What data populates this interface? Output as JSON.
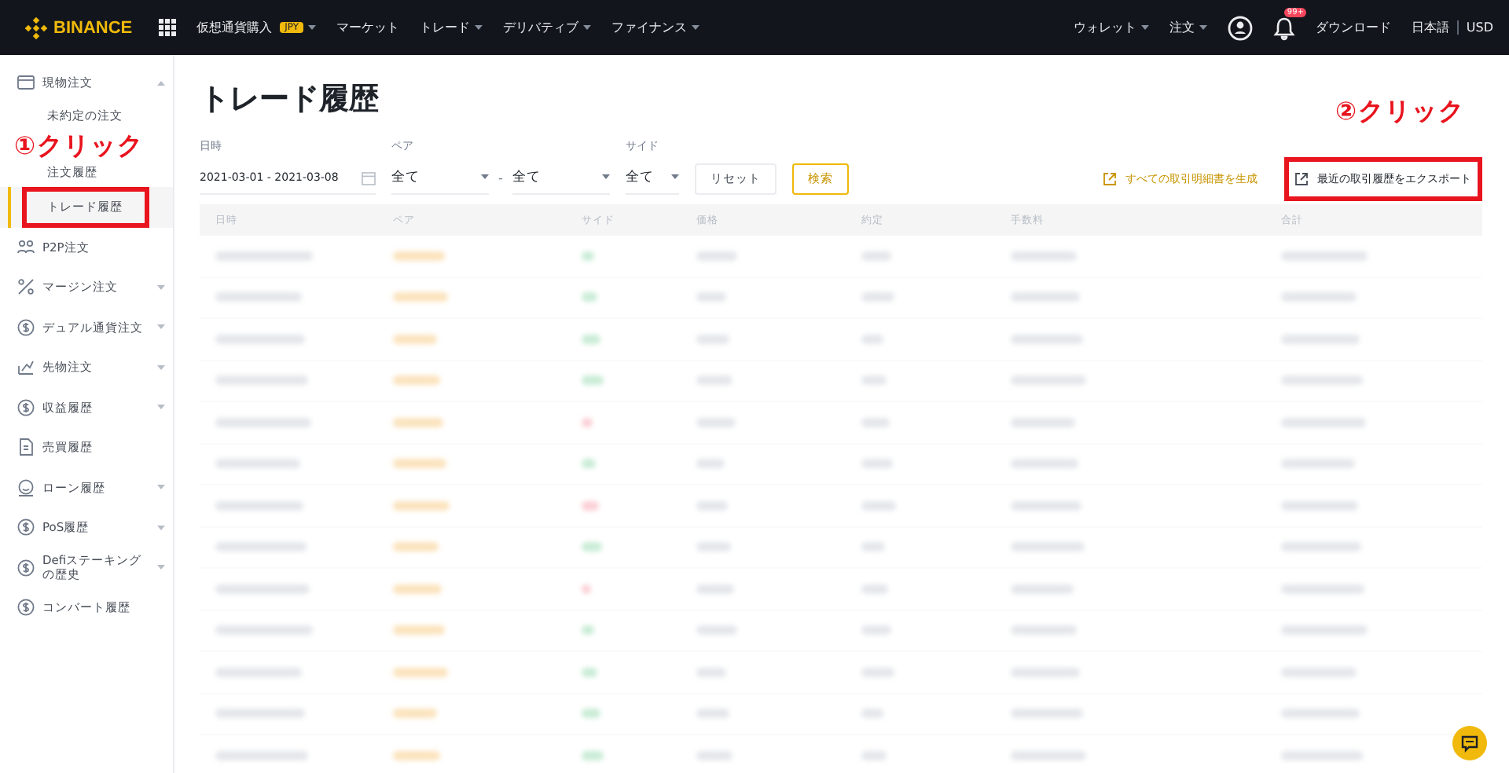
{
  "nav": {
    "logo": "BINANCE",
    "left": [
      {
        "label": "仮想通貨購入",
        "badge": "JPY",
        "dropdown": true
      },
      {
        "label": "マーケット",
        "dropdown": false
      },
      {
        "label": "トレード",
        "dropdown": true
      },
      {
        "label": "デリバティブ",
        "dropdown": true
      },
      {
        "label": "ファイナンス",
        "dropdown": true
      }
    ],
    "right": [
      {
        "kind": "link",
        "label": "ウォレット",
        "dropdown": true
      },
      {
        "kind": "link",
        "label": "注文",
        "dropdown": true
      },
      {
        "kind": "user"
      },
      {
        "kind": "bell",
        "badge": "99+"
      },
      {
        "kind": "link",
        "label": "ダウンロード",
        "dropdown": false
      },
      {
        "kind": "locale",
        "language": "日本語",
        "currency": "USD"
      }
    ]
  },
  "sidebar": {
    "items": [
      {
        "kind": "wallet",
        "label": "現物注文",
        "expandable": true,
        "expanded": true,
        "children": [
          {
            "label": "未約定の注文",
            "selected": false,
            "highlighted": false
          },
          {
            "label": "注文履歴",
            "selected": false,
            "highlighted": false
          },
          {
            "label": "トレード履歴",
            "selected": true,
            "highlighted": true
          }
        ]
      },
      {
        "kind": "p2p",
        "label": "P2P注文",
        "expandable": false
      },
      {
        "kind": "margin",
        "label": "マージン注文",
        "expandable": true,
        "expanded": false
      },
      {
        "kind": "coin",
        "label": "デュアル通貨注文",
        "expandable": true,
        "expanded": false
      },
      {
        "kind": "futures",
        "label": "先物注文",
        "expandable": true,
        "expanded": false
      },
      {
        "kind": "coin",
        "label": "収益履歴",
        "expandable": true,
        "expanded": false
      },
      {
        "kind": "document",
        "label": "売買履歴",
        "expandable": false
      },
      {
        "kind": "loan",
        "label": "ローン履歴",
        "expandable": true,
        "expanded": false
      },
      {
        "kind": "coin",
        "label": "PoS履歴",
        "expandable": true,
        "expanded": false
      },
      {
        "kind": "coin",
        "label": "Defiステーキングの歴史",
        "expandable": true,
        "expanded": false
      },
      {
        "kind": "coin",
        "label": "コンバート履歴",
        "expandable": false
      }
    ]
  },
  "page": {
    "title": "トレード履歴"
  },
  "filters": {
    "date": {
      "label": "日時",
      "value": "2021-03-01 - 2021-03-08"
    },
    "pair": {
      "label": "ペア",
      "base": "全て",
      "separator": "-",
      "quote": "全て"
    },
    "side": {
      "label": "サイド",
      "value": "全て"
    },
    "buttons": [
      {
        "kind": "plain",
        "label": "リセット"
      },
      {
        "kind": "primary",
        "label": "検索"
      }
    ]
  },
  "actions": [
    {
      "kind": "accent",
      "label": "すべての取引明細書を生成",
      "highlighted": false
    },
    {
      "kind": "plain",
      "label": "最近の取引履歴をエクスポート",
      "highlighted": true
    }
  ],
  "table": {
    "columns": [
      "日時",
      "ペア",
      "サイド",
      "価格",
      "約定",
      "手数料",
      "合計"
    ],
    "rows": [
      {
        "kind": "buy"
      },
      {
        "kind": "buy"
      },
      {
        "kind": "buy"
      },
      {
        "kind": "buy"
      },
      {
        "kind": "sell"
      },
      {
        "kind": "buy"
      },
      {
        "kind": "sell"
      },
      {
        "kind": "buy"
      },
      {
        "kind": "sell"
      },
      {
        "kind": "buy"
      },
      {
        "kind": "buy"
      },
      {
        "kind": "buy"
      },
      {
        "kind": "buy"
      }
    ]
  },
  "annotations": [
    {
      "text": "①クリック"
    },
    {
      "text": "②クリック"
    }
  ]
}
